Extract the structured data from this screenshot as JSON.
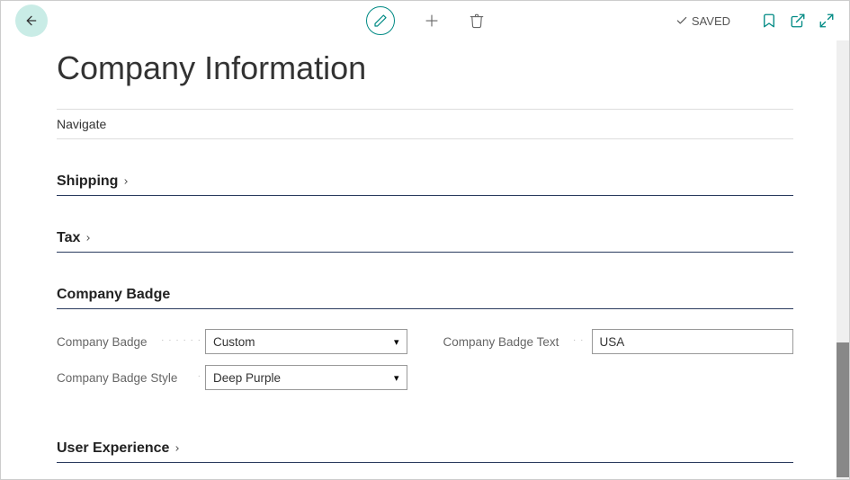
{
  "header": {
    "saved_label": "SAVED"
  },
  "page": {
    "title": "Company Information",
    "navigate_label": "Navigate"
  },
  "sections": {
    "shipping": {
      "title": "Shipping"
    },
    "tax": {
      "title": "Tax"
    },
    "company_badge": {
      "title": "Company Badge"
    },
    "user_experience": {
      "title": "User Experience"
    }
  },
  "fields": {
    "company_badge": {
      "label": "Company Badge",
      "value": "Custom"
    },
    "company_badge_text": {
      "label": "Company Badge Text",
      "value": "USA"
    },
    "company_badge_style": {
      "label": "Company Badge Style",
      "value": "Deep Purple"
    }
  }
}
